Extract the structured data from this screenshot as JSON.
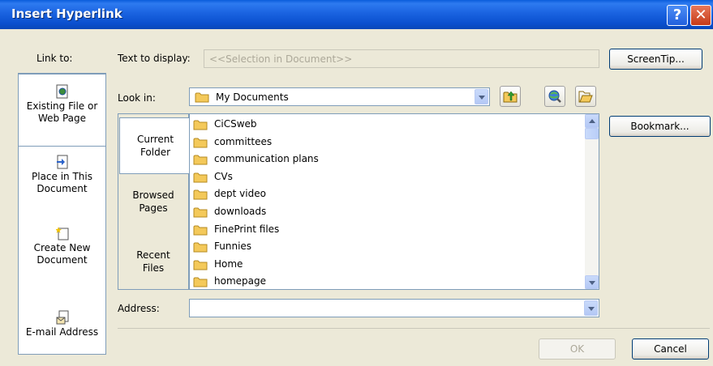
{
  "window": {
    "title": "Insert Hyperlink",
    "help_glyph": "?",
    "close_glyph": "✕"
  },
  "link_to": {
    "heading": "Link to:",
    "items": [
      {
        "line1": "Existing File or",
        "line2": "Web Page",
        "icon": "existing-file-icon"
      },
      {
        "line1": "Place in This",
        "line2": "Document",
        "icon": "place-in-document-icon"
      },
      {
        "line1": "Create New",
        "line2": "Document",
        "icon": "create-new-document-icon"
      },
      {
        "line1": "E-mail Address",
        "line2": "",
        "icon": "email-address-icon"
      }
    ]
  },
  "text_to_display": {
    "label": "Text to display:",
    "value": "<<Selection in Document>>"
  },
  "screentip_button": "ScreenTip...",
  "look_in": {
    "label": "Look in:",
    "value": "My Documents"
  },
  "subnav": [
    {
      "line1": "Current",
      "line2": "Folder"
    },
    {
      "line1": "Browsed",
      "line2": "Pages"
    },
    {
      "line1": "Recent",
      "line2": "Files"
    }
  ],
  "files": [
    "CiCSweb",
    "committees",
    "communication plans",
    "CVs",
    "dept video",
    "downloads",
    "FinePrint files",
    "Funnies",
    "Home",
    "homepage"
  ],
  "bookmark_button": "Bookmark...",
  "address": {
    "label": "Address:",
    "value": ""
  },
  "ok_button": "OK",
  "cancel_button": "Cancel",
  "colors": {
    "titlebar": "#0A5DDB",
    "dialog_bg": "#ECE9D8",
    "field_border": "#7F9DB9",
    "folder": "#F4C95A"
  }
}
